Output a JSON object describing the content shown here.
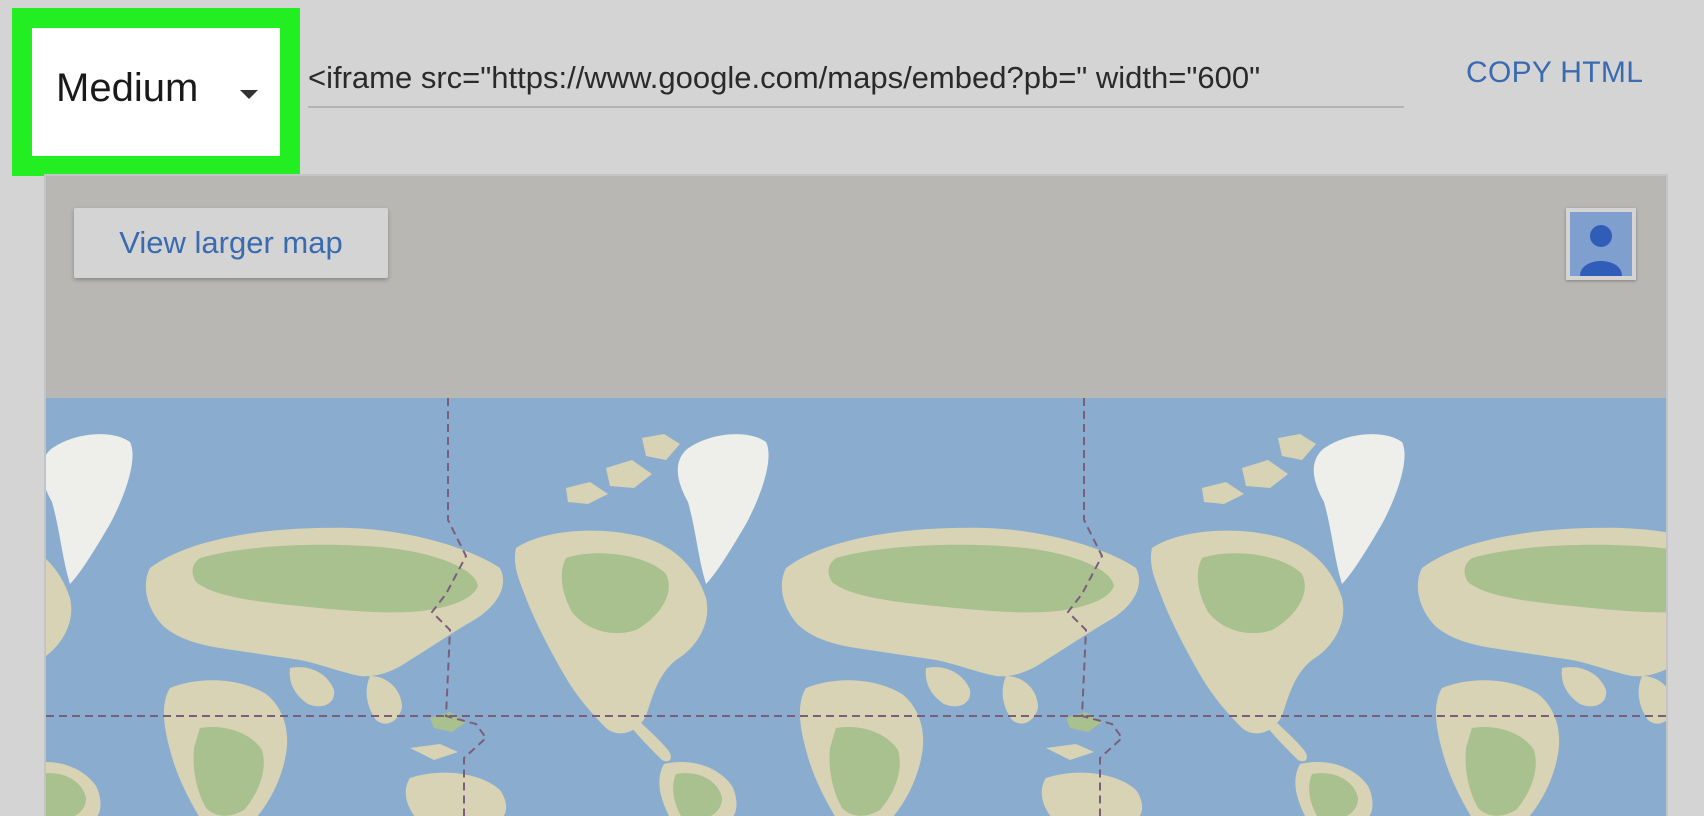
{
  "size_selector": {
    "selected": "Medium",
    "highlight_color": "#22ee22"
  },
  "embed": {
    "code": "<iframe src=\"https://www.google.com/maps/embed?pb=\" width=\"600\""
  },
  "actions": {
    "copy_html_label": "COPY HTML"
  },
  "map": {
    "view_larger_label": "View larger map",
    "water_color": "#8aadcf",
    "land_color": "#d8d3b4",
    "forest_color": "#a9c08f",
    "ice_color": "#eeeeea",
    "account_icon": "person-icon"
  },
  "colors": {
    "link": "#3a6bb0",
    "background": "#d4d4d4"
  }
}
